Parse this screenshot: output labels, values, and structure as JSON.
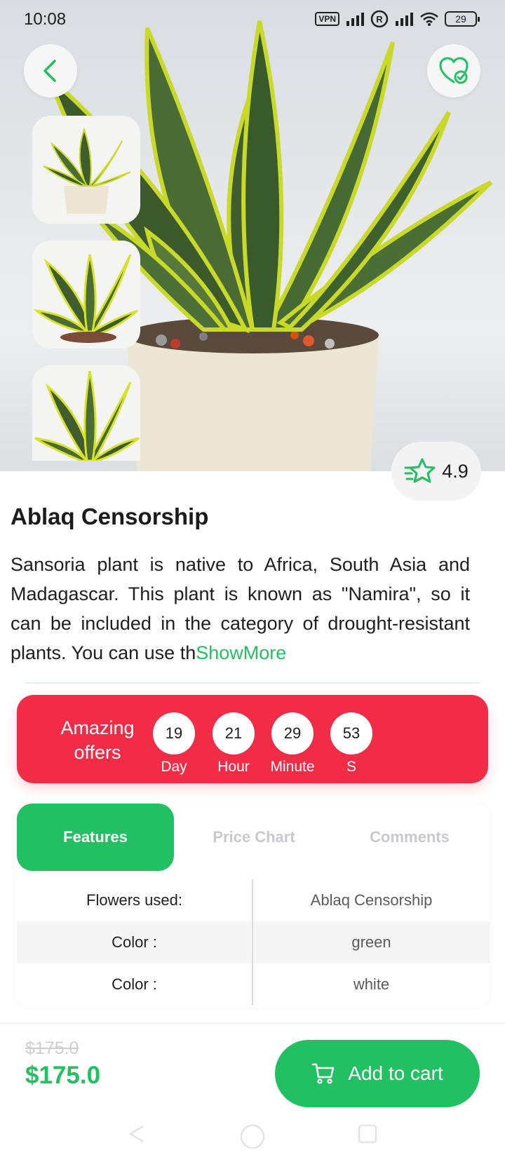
{
  "status_bar": {
    "time": "10:08",
    "vpn": "VPN",
    "battery": "29"
  },
  "product": {
    "title": "Ablaq Censorship",
    "description": "Sansoria plant is native to Africa, South Asia and Madagascar. This plant is known as \"Namira\", so it can be included in the category of drought-resistant plants. You can use th",
    "show_more": "ShowMore",
    "rating": "4.9"
  },
  "offers": {
    "title": "Amazing offers",
    "countdown": [
      {
        "value": "19",
        "label": "Day"
      },
      {
        "value": "21",
        "label": "Hour"
      },
      {
        "value": "29",
        "label": "Minute"
      },
      {
        "value": "53",
        "label": "S"
      }
    ]
  },
  "tabs": [
    {
      "label": "Features",
      "active": true
    },
    {
      "label": "Price Chart",
      "active": false
    },
    {
      "label": "Comments",
      "active": false
    }
  ],
  "features": [
    {
      "key": "Flowers used:",
      "value": "Ablaq Censorship"
    },
    {
      "key": "Color :",
      "value": "green"
    },
    {
      "key": "Color :",
      "value": "white"
    }
  ],
  "pricing": {
    "old_price": "$175.0",
    "new_price": "$175.0",
    "add_to_cart": "Add to cart"
  },
  "icons": {
    "back": "chevron-left-icon",
    "favorite": "heart-check-icon",
    "rating": "star-icon",
    "cart": "cart-icon"
  },
  "colors": {
    "accent": "#23bf63",
    "offer": "#f22c47"
  }
}
